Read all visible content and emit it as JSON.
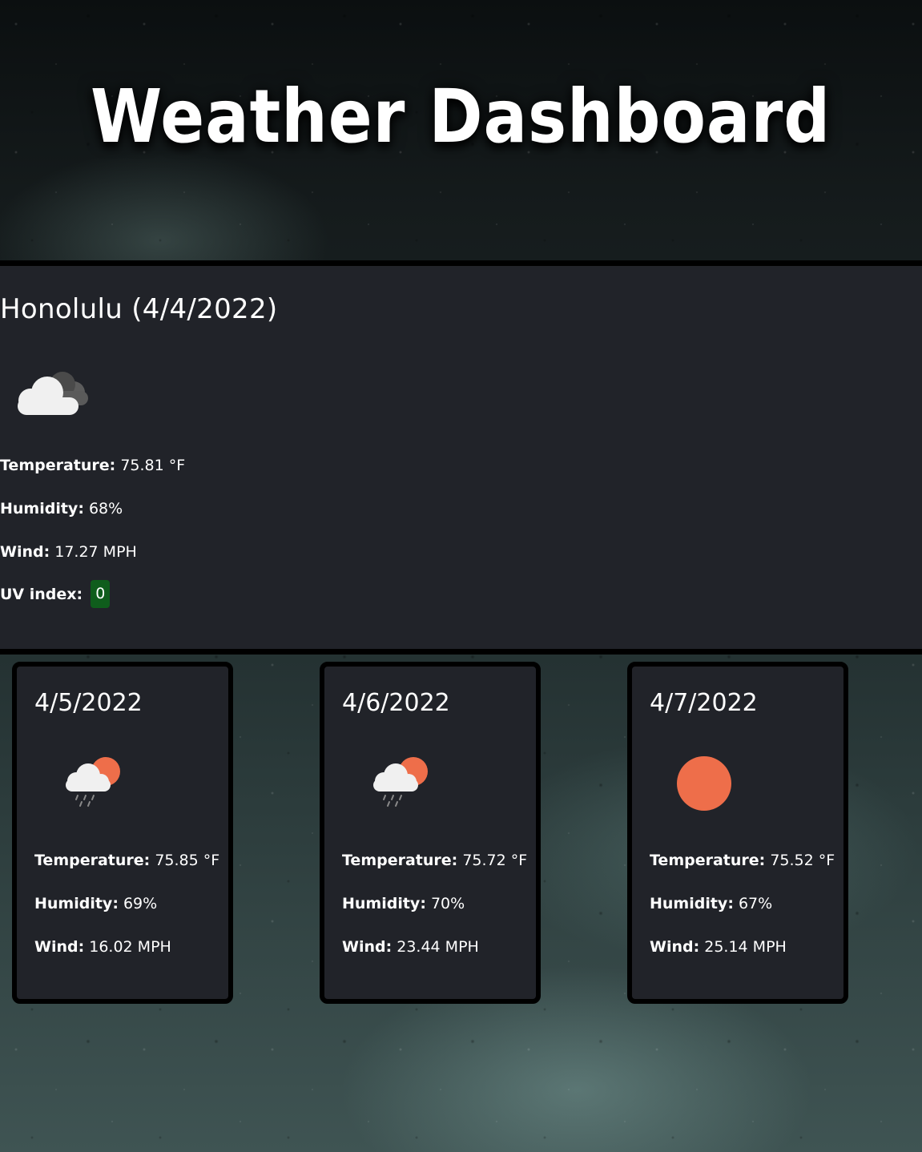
{
  "header": {
    "title": "Weather Dashboard"
  },
  "current": {
    "title": "Honolulu (4/4/2022)",
    "icon": "broken-clouds-icon",
    "temperature_label": "Temperature:",
    "temperature_value": "75.81 °F",
    "humidity_label": "Humidity:",
    "humidity_value": "68%",
    "wind_label": "Wind:",
    "wind_value": "17.27 MPH",
    "uv_label": "UV index:",
    "uv_value": "0",
    "uv_color": "#0f5d1c"
  },
  "forecast": [
    {
      "date": "4/5/2022",
      "icon": "sun-rain-cloud-icon",
      "temperature_label": "Temperature:",
      "temperature_value": "75.85 °F",
      "humidity_label": "Humidity:",
      "humidity_value": "69%",
      "wind_label": "Wind:",
      "wind_value": "16.02 MPH"
    },
    {
      "date": "4/6/2022",
      "icon": "sun-rain-cloud-icon",
      "temperature_label": "Temperature:",
      "temperature_value": "75.72 °F",
      "humidity_label": "Humidity:",
      "humidity_value": "70%",
      "wind_label": "Wind:",
      "wind_value": "23.44 MPH"
    },
    {
      "date": "4/7/2022",
      "icon": "clear-sun-icon",
      "temperature_label": "Temperature:",
      "temperature_value": "75.52 °F",
      "humidity_label": "Humidity:",
      "humidity_value": "67%",
      "wind_label": "Wind:",
      "wind_value": "25.14 MPH"
    }
  ],
  "colors": {
    "panel": "#212329",
    "sun": "#ee6e4a",
    "cloud": "#f0f0f0",
    "dark_cloud": "#5a5a5a"
  }
}
